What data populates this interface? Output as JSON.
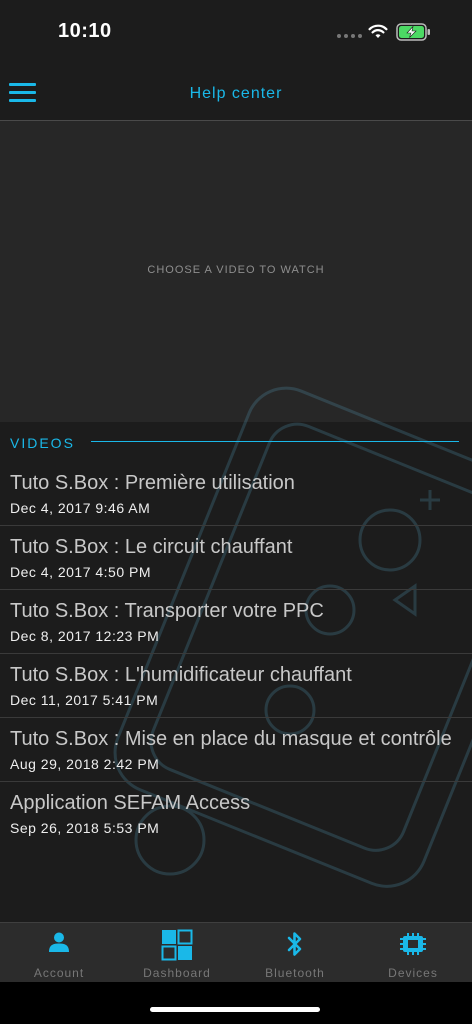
{
  "status": {
    "time": "10:10"
  },
  "header": {
    "title": "Help center"
  },
  "player": {
    "prompt": "CHOOSE A VIDEO TO WATCH"
  },
  "videos": {
    "section_label": "VIDEOS",
    "items": [
      {
        "title": "Tuto S.Box : Première utilisation",
        "date": "Dec 4, 2017 9:46 AM"
      },
      {
        "title": "Tuto S.Box : Le circuit chauffant",
        "date": "Dec 4, 2017 4:50 PM"
      },
      {
        "title": "Tuto S.Box : Transporter votre PPC",
        "date": "Dec 8, 2017 12:23 PM"
      },
      {
        "title": "Tuto S.Box : L'humidificateur chauffant",
        "date": "Dec 11, 2017 5:41 PM"
      },
      {
        "title": "Tuto S.Box : Mise en place du masque et contrôle",
        "date": "Aug 29, 2018 2:42 PM"
      },
      {
        "title": "Application SEFAM Access",
        "date": "Sep 26, 2018 5:53 PM"
      }
    ]
  },
  "tabs": [
    {
      "label": "Account",
      "icon": "person-icon"
    },
    {
      "label": "Dashboard",
      "icon": "grid-icon"
    },
    {
      "label": "Bluetooth",
      "icon": "bluetooth-icon"
    },
    {
      "label": "Devices",
      "icon": "chip-icon"
    }
  ],
  "colors": {
    "accent": "#1ab8e8",
    "background": "#1c1c1c",
    "battery": "#4cd964"
  }
}
